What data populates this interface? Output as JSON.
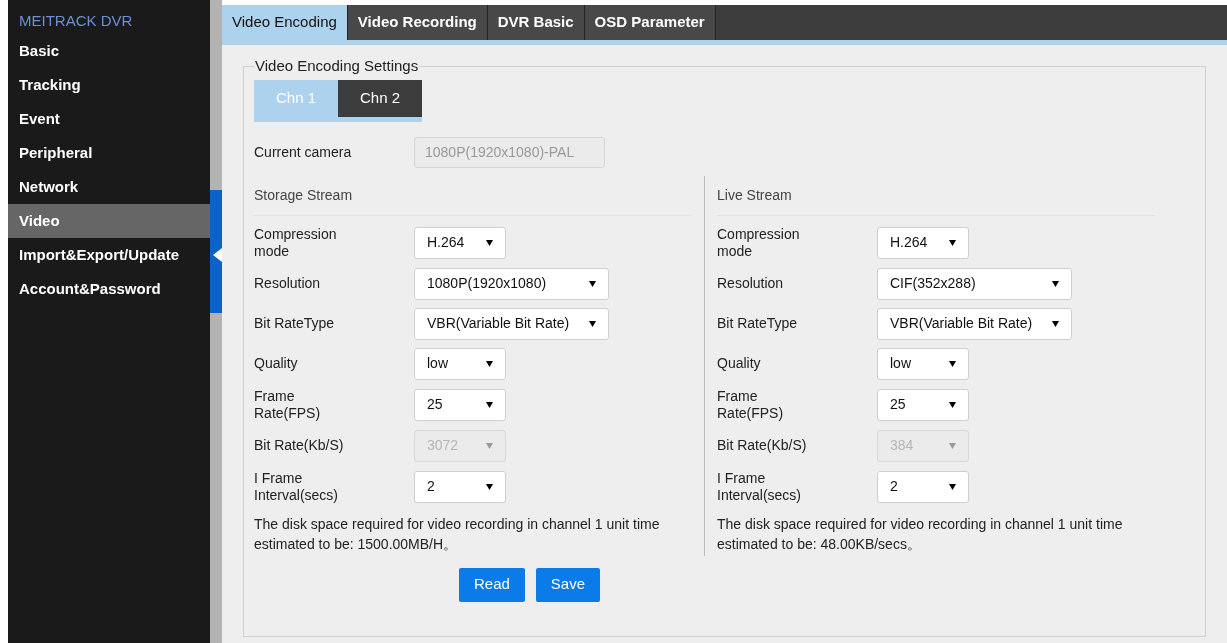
{
  "sidebar": {
    "brand": "MEITRACK DVR",
    "items": [
      {
        "label": "Basic",
        "selected": false
      },
      {
        "label": "Tracking",
        "selected": false
      },
      {
        "label": "Event",
        "selected": false
      },
      {
        "label": "Peripheral",
        "selected": false
      },
      {
        "label": "Network",
        "selected": false
      },
      {
        "label": "Video",
        "selected": true
      },
      {
        "label": "Import&Export/Update",
        "selected": false
      },
      {
        "label": "Account&Password",
        "selected": false
      }
    ]
  },
  "tabs": [
    {
      "label": "Video Encoding",
      "selected": true
    },
    {
      "label": "Video Recording",
      "selected": false
    },
    {
      "label": "DVR Basic",
      "selected": false
    },
    {
      "label": "OSD Parameter",
      "selected": false
    }
  ],
  "settings": {
    "legend": "Video Encoding Settings",
    "channels": [
      {
        "label": "Chn 1",
        "selected": true
      },
      {
        "label": "Chn 2",
        "selected": false
      }
    ],
    "current_camera": {
      "label": "Current camera",
      "value": "1080P(1920x1080)-PAL"
    },
    "streams": [
      {
        "title": "Storage Stream",
        "rows": [
          {
            "label": "Compression mode",
            "value": "H.264",
            "kind": "narrow",
            "disabled": false
          },
          {
            "label": "Resolution",
            "value": "1080P(1920x1080)",
            "kind": "wide",
            "disabled": false
          },
          {
            "label": "Bit RateType",
            "value": "VBR(Variable Bit Rate)",
            "kind": "wide",
            "disabled": false
          },
          {
            "label": "Quality",
            "value": "low",
            "kind": "narrow",
            "disabled": false
          },
          {
            "label": "Frame Rate(FPS)",
            "value": "25",
            "kind": "narrow",
            "disabled": false
          },
          {
            "label": "Bit Rate(Kb/S)",
            "value": "3072",
            "kind": "narrow",
            "disabled": true
          },
          {
            "label": "I Frame Interval(secs)",
            "value": "2",
            "kind": "narrow",
            "disabled": false
          }
        ],
        "note": "The disk space required for video recording in channel 1 unit time estimated to be: 1500.00MB/H。"
      },
      {
        "title": "Live Stream",
        "rows": [
          {
            "label": "Compression mode",
            "value": "H.264",
            "kind": "narrow",
            "disabled": false
          },
          {
            "label": "Resolution",
            "value": "CIF(352x288)",
            "kind": "wide",
            "disabled": false
          },
          {
            "label": "Bit RateType",
            "value": "VBR(Variable Bit Rate)",
            "kind": "wide",
            "disabled": false
          },
          {
            "label": "Quality",
            "value": "low",
            "kind": "narrow",
            "disabled": false
          },
          {
            "label": "Frame Rate(FPS)",
            "value": "25",
            "kind": "narrow",
            "disabled": false
          },
          {
            "label": "Bit Rate(Kb/S)",
            "value": "384",
            "kind": "narrow",
            "disabled": true
          },
          {
            "label": "I Frame Interval(secs)",
            "value": "2",
            "kind": "narrow",
            "disabled": false
          }
        ],
        "note": "The disk space required for video recording in channel 1 unit time estimated to be: 48.00KB/secs。"
      }
    ],
    "buttons": [
      "Read",
      "Save"
    ]
  }
}
